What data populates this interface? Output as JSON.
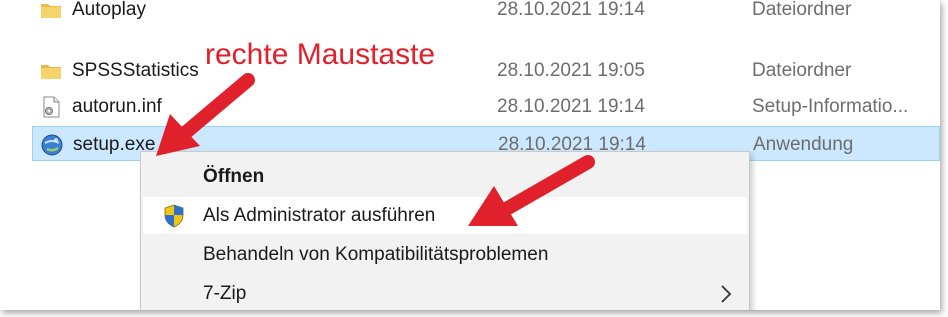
{
  "file_list": {
    "rows": [
      {
        "name": "Autoplay",
        "date": "28.10.2021 19:14",
        "type": "Dateiordner",
        "icon": "folder-icon"
      },
      {
        "name": "SPSSStatistics",
        "date": "28.10.2021 19:05",
        "type": "Dateiordner",
        "icon": "folder-icon"
      },
      {
        "name": "autorun.inf",
        "date": "28.10.2021 19:14",
        "type": "Setup-Informatio...",
        "icon": "setup-info-file-icon"
      },
      {
        "name": "setup.exe",
        "date": "28.10.2021 19:14",
        "type": "Anwendung",
        "icon": "setup-exe-icon",
        "selected": true
      }
    ]
  },
  "annotation": {
    "label": "rechte Maustaste",
    "color": "#e0202a"
  },
  "context_menu": {
    "items": [
      {
        "label": "Öffnen",
        "bold": true
      },
      {
        "label": "Als Administrator ausführen",
        "icon": "uac-shield-icon",
        "hover": true
      },
      {
        "label": "Behandeln von Kompatibilitätsproblemen"
      },
      {
        "label": "7-Zip",
        "submenu": true,
        "icon": "chevron-right-icon"
      }
    ]
  },
  "colors": {
    "selection_bg": "#cce8ff",
    "selection_border": "#99d1ff",
    "menu_bg": "#f2f2f2",
    "arrow": "#e0202a"
  }
}
